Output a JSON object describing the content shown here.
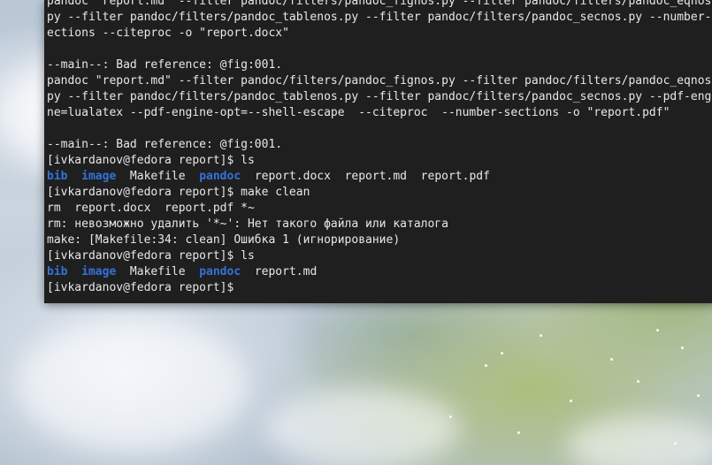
{
  "colors": {
    "terminal_bg": "#1f1f1f",
    "terminal_text": "#e8e8e8",
    "directory_text": "#3572d9"
  },
  "terminal": {
    "lines": [
      {
        "segments": [
          {
            "text": "pandoc \"report.md\" --filter pandoc/filters/pandoc_fignos.py --filter pandoc/filters/pandoc_eqnos.",
            "kind": "normal"
          }
        ]
      },
      {
        "segments": [
          {
            "text": "py --filter pandoc/filters/pandoc_tablenos.py --filter pandoc/filters/pandoc_secnos.py --number-s",
            "kind": "normal"
          }
        ]
      },
      {
        "segments": [
          {
            "text": "ections --citeproc -o \"report.docx\"",
            "kind": "normal"
          }
        ]
      },
      {
        "segments": [
          {
            "text": "",
            "kind": "normal"
          }
        ]
      },
      {
        "segments": [
          {
            "text": "--main--: Bad reference: @fig:001.",
            "kind": "normal"
          }
        ]
      },
      {
        "segments": [
          {
            "text": "pandoc \"report.md\" --filter pandoc/filters/pandoc_fignos.py --filter pandoc/filters/pandoc_eqnos.",
            "kind": "normal"
          }
        ]
      },
      {
        "segments": [
          {
            "text": "py --filter pandoc/filters/pandoc_tablenos.py --filter pandoc/filters/pandoc_secnos.py --pdf-engi",
            "kind": "normal"
          }
        ]
      },
      {
        "segments": [
          {
            "text": "ne=lualatex --pdf-engine-opt=--shell-escape  --citeproc  --number-sections -o \"report.pdf\"",
            "kind": "normal"
          }
        ]
      },
      {
        "segments": [
          {
            "text": "",
            "kind": "normal"
          }
        ]
      },
      {
        "segments": [
          {
            "text": "--main--: Bad reference: @fig:001.",
            "kind": "normal"
          }
        ]
      },
      {
        "segments": [
          {
            "text": "[ivkardanov@fedora report]$ ls",
            "kind": "normal"
          }
        ]
      },
      {
        "segments": [
          {
            "text": "bib",
            "kind": "dir"
          },
          {
            "text": "  ",
            "kind": "normal"
          },
          {
            "text": "image",
            "kind": "dir"
          },
          {
            "text": "  Makefile  ",
            "kind": "normal"
          },
          {
            "text": "pandoc",
            "kind": "dir"
          },
          {
            "text": "  report.docx  report.md  report.pdf",
            "kind": "normal"
          }
        ]
      },
      {
        "segments": [
          {
            "text": "[ivkardanov@fedora report]$ make clean",
            "kind": "normal"
          }
        ]
      },
      {
        "segments": [
          {
            "text": "rm  report.docx  report.pdf *~",
            "kind": "normal"
          }
        ]
      },
      {
        "segments": [
          {
            "text": "rm: невозможно удалить '*~': Нет такого файла или каталога",
            "kind": "normal"
          }
        ]
      },
      {
        "segments": [
          {
            "text": "make: [Makefile:34: clean] Ошибка 1 (игнорирование)",
            "kind": "normal"
          }
        ]
      },
      {
        "segments": [
          {
            "text": "[ivkardanov@fedora report]$ ls",
            "kind": "normal"
          }
        ]
      },
      {
        "segments": [
          {
            "text": "bib",
            "kind": "dir"
          },
          {
            "text": "  ",
            "kind": "normal"
          },
          {
            "text": "image",
            "kind": "dir"
          },
          {
            "text": "  Makefile  ",
            "kind": "normal"
          },
          {
            "text": "pandoc",
            "kind": "dir"
          },
          {
            "text": "  report.md",
            "kind": "normal"
          }
        ]
      },
      {
        "segments": [
          {
            "text": "[ivkardanov@fedora report]$ ",
            "kind": "normal"
          }
        ]
      }
    ]
  }
}
